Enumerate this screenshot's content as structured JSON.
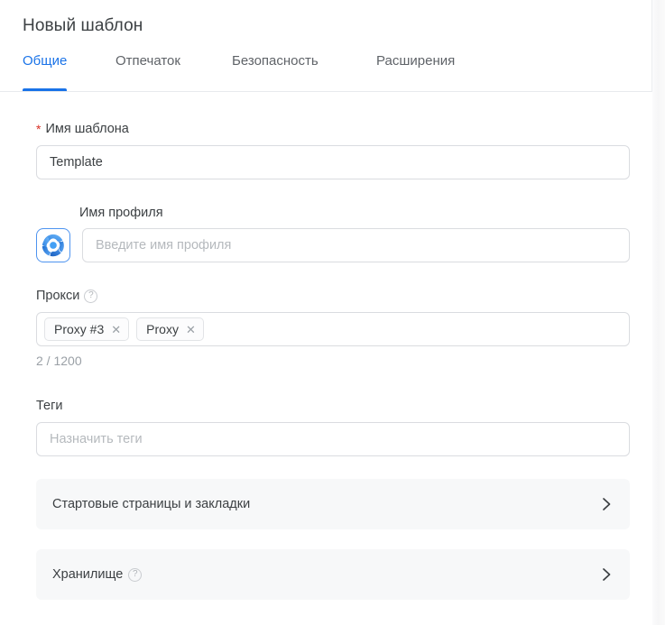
{
  "header": {
    "title": "Новый шаблон"
  },
  "tabs": [
    {
      "label": "Общие",
      "active": true
    },
    {
      "label": "Отпечаток",
      "active": false
    },
    {
      "label": "Безопасность",
      "active": false
    },
    {
      "label": "Расширения",
      "active": false
    }
  ],
  "form": {
    "template_name": {
      "label": "Имя шаблона",
      "required_marker": "*",
      "value": "Template"
    },
    "profile_name": {
      "label": "Имя профиля",
      "placeholder": "Введите имя профиля",
      "value": "",
      "avatar_icon": "browser-profile-logo-icon"
    },
    "proxy": {
      "label": "Прокси",
      "help_icon": "help-circle-icon",
      "help_glyph": "?",
      "tags": [
        {
          "label": "Proxy #3",
          "remove_glyph": "✕"
        },
        {
          "label": "Proxy",
          "remove_glyph": "✕"
        }
      ],
      "counter": "2 / 1200"
    },
    "tags": {
      "label": "Теги",
      "placeholder": "Назначить теги",
      "value": ""
    },
    "start_pages": {
      "label": "Стартовые страницы и закладки",
      "chevron_icon": "chevron-right-icon"
    },
    "storage": {
      "label": "Хранилище",
      "help_icon": "help-circle-icon",
      "help_glyph": "?",
      "chevron_icon": "chevron-right-icon"
    }
  },
  "colors": {
    "accent": "#1a73e8",
    "required": "#d93025",
    "text": "#3c4043",
    "muted": "#9aa0a6",
    "border": "#dadce0",
    "row_bg": "#f7f8f9"
  }
}
